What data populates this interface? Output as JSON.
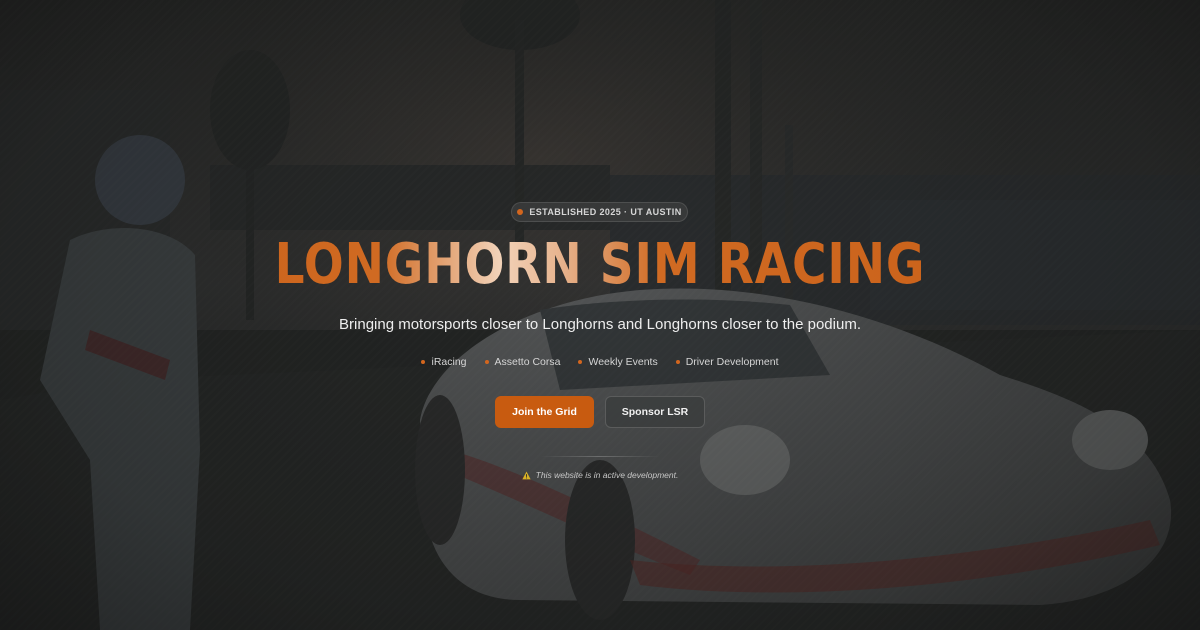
{
  "hero": {
    "badge": "ESTABLISHED 2025 · UT AUSTIN",
    "title": "LONGHORN SIM RACING",
    "tagline": "Bringing motorsports closer to Longhorns and Longhorns closer to the podium.",
    "features": [
      {
        "label": "iRacing"
      },
      {
        "label": "Assetto Corsa"
      },
      {
        "label": "Weekly Events"
      },
      {
        "label": "Driver Development"
      }
    ],
    "primary_button": "Join the Grid",
    "secondary_button": "Sponsor LSR",
    "dev_notice": "This website is in active development.",
    "icons": {
      "badge": "status-dot-icon",
      "feature": "bullet-dot-icon",
      "notice": "warning-triangle-icon"
    }
  },
  "colors": {
    "accent": "#c85b10",
    "title_orange": "#d0661c",
    "background": "#232423",
    "text": "#eeeeee",
    "muted_text": "#d5d5d5",
    "warning": "#d8b126"
  }
}
